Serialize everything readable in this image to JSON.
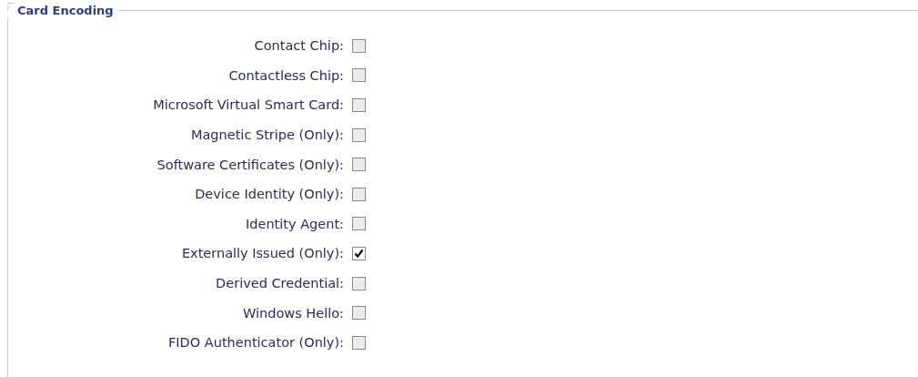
{
  "section": {
    "title": "Card Encoding",
    "options": [
      {
        "label": "Contact Chip:",
        "checked": false
      },
      {
        "label": "Contactless Chip:",
        "checked": false
      },
      {
        "label": "Microsoft Virtual Smart Card:",
        "checked": false
      },
      {
        "label": "Magnetic Stripe (Only):",
        "checked": false
      },
      {
        "label": "Software Certificates (Only):",
        "checked": false
      },
      {
        "label": "Device Identity (Only):",
        "checked": false
      },
      {
        "label": "Identity Agent:",
        "checked": false
      },
      {
        "label": "Externally Issued (Only):",
        "checked": true
      },
      {
        "label": "Derived Credential:",
        "checked": false
      },
      {
        "label": "Windows Hello:",
        "checked": false
      },
      {
        "label": "FIDO Authenticator (Only):",
        "checked": false
      }
    ]
  }
}
